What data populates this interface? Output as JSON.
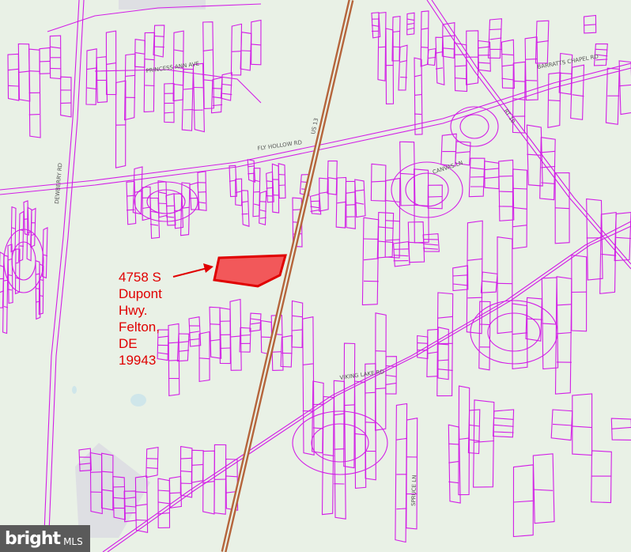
{
  "map": {
    "property_label_lines": [
      "4758 S",
      "Dupont",
      "Hwy.",
      "Felton,",
      "DE",
      "19943"
    ],
    "roads": [
      {
        "name": "PRINCESS ANN AVE"
      },
      {
        "name": "BARRATTS CHAPEL RD"
      },
      {
        "name": "FLY HOLLOW RD"
      },
      {
        "name": "US 13"
      },
      {
        "name": "RT 10"
      },
      {
        "name": "VIKING LAKE RD"
      },
      {
        "name": "CANVAS LN"
      },
      {
        "name": "DEWBERRY RD"
      },
      {
        "name": "SPRUCE LN"
      }
    ],
    "colors": {
      "background": "#e9f1e6",
      "parcel_lines": "#d21ee6",
      "highlight_fill": "#f2585a",
      "highlight_stroke": "#e00000",
      "highway": "#b5653c",
      "pond": "#cfe6ea"
    }
  },
  "watermark": {
    "brand": "bright",
    "suffix": "MLS"
  }
}
